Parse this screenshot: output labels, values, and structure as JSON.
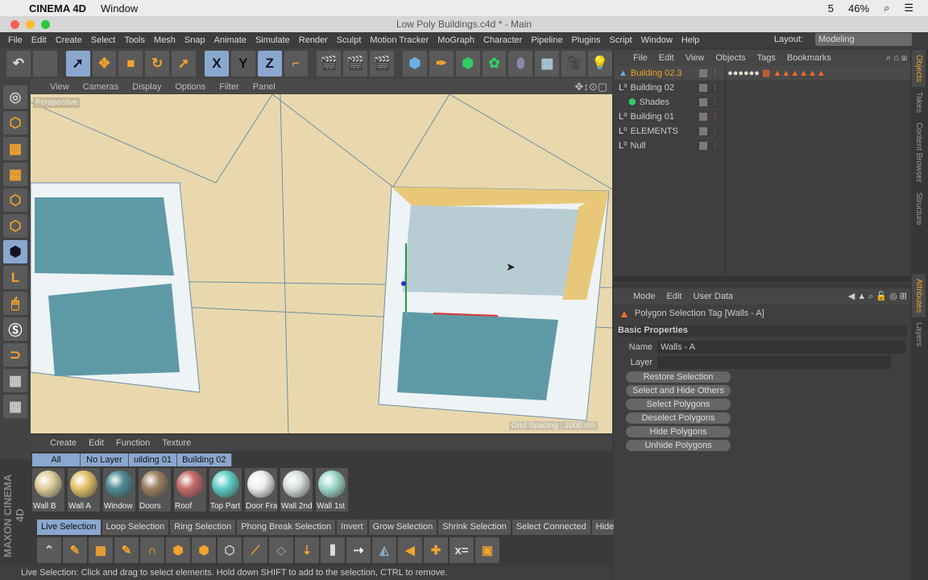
{
  "macbar": {
    "app": "CINEMA 4D",
    "menu": "Window",
    "battery": "46%",
    "adobe_count": "5"
  },
  "window": {
    "title": "Low Poly Buildings.c4d * - Main"
  },
  "menu": [
    "File",
    "Edit",
    "Create",
    "Select",
    "Tools",
    "Mesh",
    "Snap",
    "Animate",
    "Simulate",
    "Render",
    "Sculpt",
    "Motion Tracker",
    "MoGraph",
    "Character",
    "Pipeline",
    "Plugins",
    "Script",
    "Window",
    "Help"
  ],
  "layout": {
    "label": "Layout:",
    "value": "Modeling"
  },
  "toolbar": {
    "x": "X",
    "y": "Y",
    "z": "Z"
  },
  "viewport": {
    "menu": [
      "View",
      "Cameras",
      "Display",
      "Options",
      "Filter",
      "Panel"
    ],
    "camera": "Perspective",
    "grid": "Grid Spacing : 1000 cm"
  },
  "material_manager": {
    "menu": [
      "Create",
      "Edit",
      "Function",
      "Texture"
    ],
    "tabs": [
      "All",
      "No Layer",
      "uilding 01",
      "Building 02"
    ],
    "materials": [
      {
        "name": "Wall B",
        "color": "#e0cf9a"
      },
      {
        "name": "Wall A",
        "color": "#e3c36a"
      },
      {
        "name": "Window",
        "color": "#4e8c96"
      },
      {
        "name": "Doors",
        "color": "#9a8060"
      },
      {
        "name": "Roof",
        "color": "#c46a6a"
      },
      {
        "name": "Top Part",
        "color": "#5fcfc6"
      },
      {
        "name": "Door Fra",
        "color": "#eeeeee"
      },
      {
        "name": "Wall 2nd",
        "color": "#d9dede"
      },
      {
        "name": "Wall 1st",
        "color": "#9fd9cc"
      }
    ]
  },
  "commands": [
    "Live Selection",
    "Loop Selection",
    "Ring Selection",
    "Phong Break Selection",
    "Invert",
    "Grow Selection",
    "Shrink Selection",
    "Select Connected",
    "Hide"
  ],
  "status": "Live Selection: Click and drag to select elements. Hold down SHIFT to add to the selection, CTRL to remove.",
  "brand": "MAXON CINEMA 4D",
  "objects": {
    "menu": [
      "File",
      "Edit",
      "View",
      "Objects",
      "Tags",
      "Bookmarks"
    ],
    "items": [
      {
        "name": "Building 02.3",
        "selected": true
      },
      {
        "name": "Building 02"
      },
      {
        "name": "Shades"
      },
      {
        "name": "Building 01"
      },
      {
        "name": "ELEMENTS"
      },
      {
        "name": "Null"
      }
    ]
  },
  "side_tabs": [
    "Objects",
    "Takes",
    "Content Browser",
    "Structure",
    "Attributes",
    "Layers"
  ],
  "attributes": {
    "menu": [
      "Mode",
      "Edit",
      "User Data"
    ],
    "title": "Polygon Selection Tag [Walls - A]",
    "section": "Basic Properties",
    "name_label": "Name",
    "name_value": "Walls - A",
    "layer_label": "Layer",
    "buttons": [
      "Restore Selection",
      "Select and Hide Others",
      "Select Polygons",
      "Deselect Polygons",
      "Hide Polygons",
      "Unhide Polygons"
    ]
  }
}
